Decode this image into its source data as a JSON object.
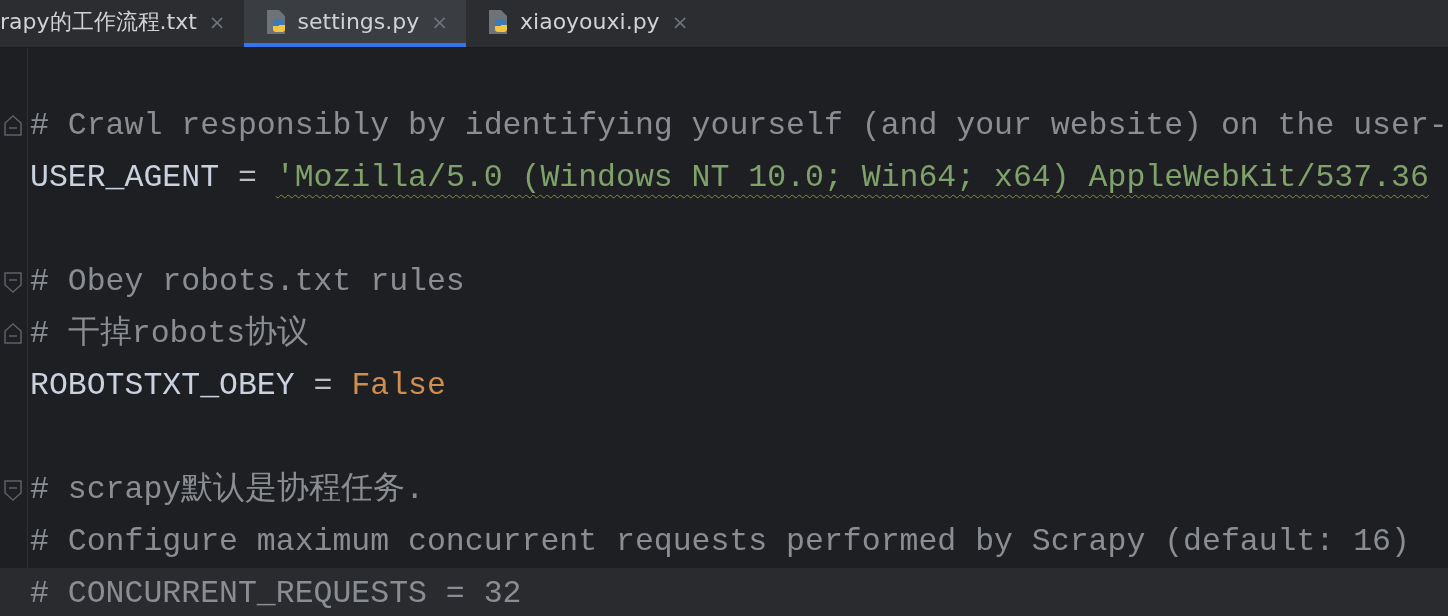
{
  "tabs": [
    {
      "label": "rapy的工作流程.txt",
      "close": "×",
      "selected": false
    },
    {
      "label": "settings.py",
      "kind": "python",
      "close": "×",
      "selected": true
    },
    {
      "label": "xiaoyouxi.py",
      "kind": "python",
      "close": "×",
      "selected": false
    }
  ],
  "editor": {
    "lines": [
      {
        "kind": "blank"
      },
      {
        "kind": "fold-end",
        "tokens": [
          {
            "kind": "comment",
            "text": "# Crawl responsibly by identifying yourself (and your website) on the user-"
          }
        ]
      },
      {
        "tokens": [
          {
            "kind": "name",
            "text": "USER_AGENT"
          },
          {
            "kind": "op",
            "text": " = "
          },
          {
            "kind": "string",
            "text": "'Mozilla/5.0 (Windows NT 10.0; Win64; x64) AppleWebKit/537.36",
            "warning": true
          }
        ]
      },
      {
        "kind": "blank"
      },
      {
        "kind": "fold-start",
        "tokens": [
          {
            "kind": "comment",
            "text": "# Obey robots.txt rules"
          }
        ]
      },
      {
        "kind": "fold-end",
        "tokens": [
          {
            "kind": "comment",
            "text": "# 干掉robots协议"
          }
        ]
      },
      {
        "tokens": [
          {
            "kind": "name",
            "text": "ROBOTSTXT_OBEY"
          },
          {
            "kind": "op",
            "text": " = "
          },
          {
            "kind": "keyword",
            "text": "False"
          }
        ]
      },
      {
        "kind": "blank"
      },
      {
        "kind": "fold-start",
        "tokens": [
          {
            "kind": "comment",
            "text": "# scrapy默认是协程任务."
          }
        ]
      },
      {
        "tokens": [
          {
            "kind": "comment",
            "text": "# Configure maximum concurrent requests performed by Scrapy (default: 16)"
          }
        ]
      },
      {
        "tokens": [
          {
            "kind": "comment",
            "text": "# CONCURRENT_REQUESTS = 32"
          }
        ],
        "current": true
      }
    ]
  }
}
